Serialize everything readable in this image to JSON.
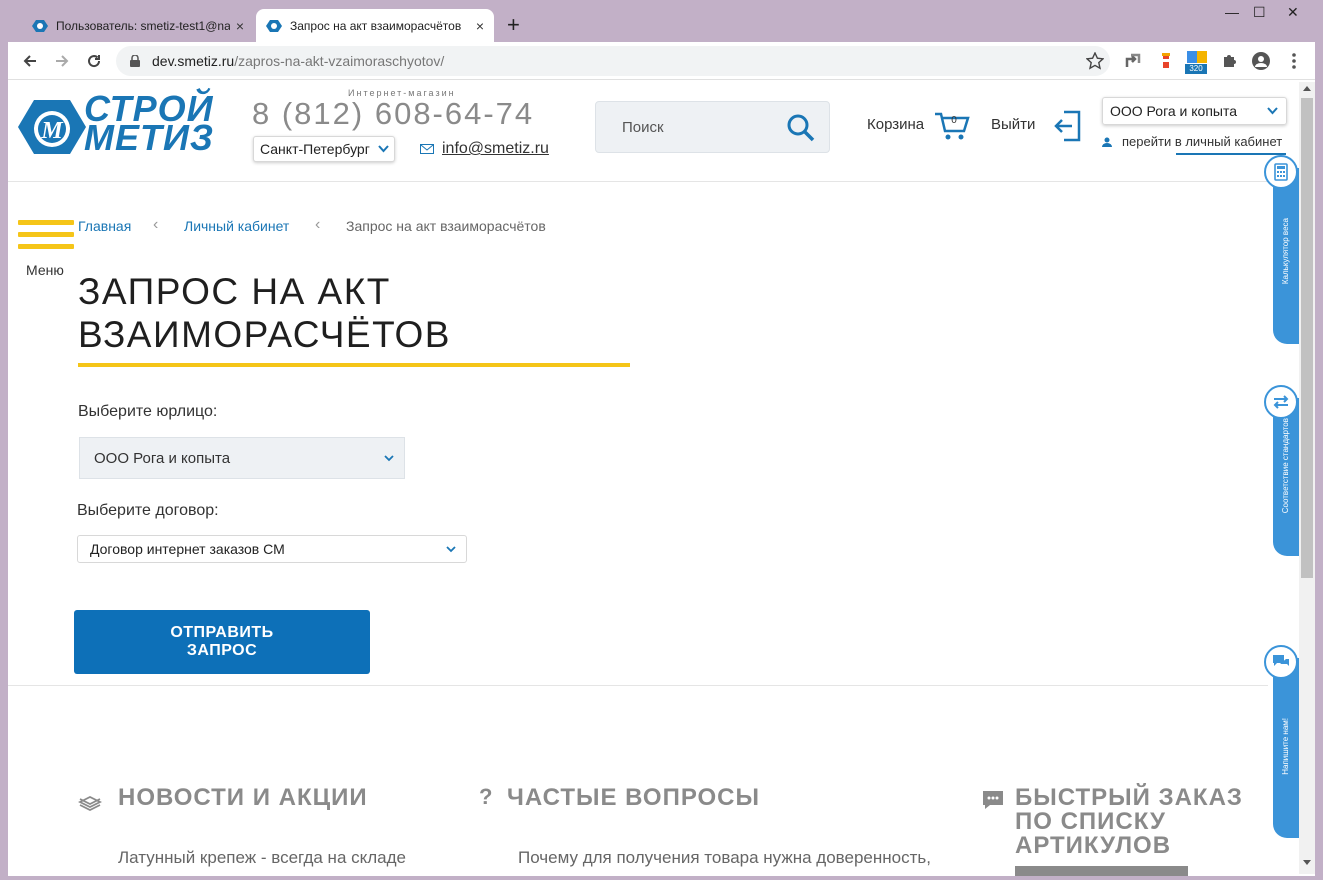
{
  "browser": {
    "tabs": [
      {
        "title": "Пользователь: smetiz-test1@na",
        "active": false
      },
      {
        "title": "Запрос на акт взаиморасчётов",
        "active": true
      }
    ],
    "new_tab": "+",
    "close_glyph": "×",
    "window_controls": {
      "minimize": "—",
      "maximize": "☐",
      "close": "✕"
    },
    "url_host": "dev.smetiz.ru",
    "url_path": "/zapros-na-akt-vzaimoraschyotov/",
    "extension_badge": "320"
  },
  "header": {
    "logo_line1": "СТРОЙ",
    "logo_line2": "МЕТИЗ",
    "logo_mark": "М",
    "shop_label": "Интернет-магазин",
    "phone": "8 (812) 608-64-74",
    "city": "Санкт-Петербург",
    "email": "info@smetiz.ru",
    "search_placeholder": "Поиск",
    "cart_label": "Корзина",
    "cart_count": "0",
    "exit_label": "Выйти",
    "org_select": "ООО Рога и копыта",
    "cabinet_link": "перейти в личный кабинет"
  },
  "menu_label": "Меню",
  "breadcrumb": [
    "Главная",
    "Личный кабинет",
    "Запрос на акт взаиморасчётов"
  ],
  "breadcrumb_sep": "‹",
  "form": {
    "title_line1": "ЗАПРОС НА АКТ",
    "title_line2": "ВЗАИМОРАСЧЁТОВ",
    "entity_label": "Выберите юрлицо:",
    "entity_value": "ООО Рога и копыта",
    "contract_label": "Выберите договор:",
    "contract_value": "Договор интернет заказов СМ",
    "submit_line1": "ОТПРАВИТЬ",
    "submit_line2": "ЗАПРОС"
  },
  "bottom": {
    "news_title": "НОВОСТИ И АКЦИИ",
    "news_item": "Латунный крепеж - всегда на складе",
    "faq_title": "ЧАСТЫЕ ВОПРОСЫ",
    "faq_item": "Почему для получения товара нужна доверенность,",
    "quick_title_l1": "БЫСТРЫЙ ЗАКАЗ",
    "quick_title_l2": "ПО СПИСКУ",
    "quick_title_l3": "АРТИКУЛОВ"
  },
  "side_widgets": [
    "Калькулятор веса",
    "Соответствие стандартов",
    "Напишите нам!"
  ],
  "colors": {
    "brand_blue": "#1a76b5",
    "button_blue": "#0d70b8",
    "accent_yellow": "#f5c518",
    "side_blue": "#3b94d9"
  }
}
